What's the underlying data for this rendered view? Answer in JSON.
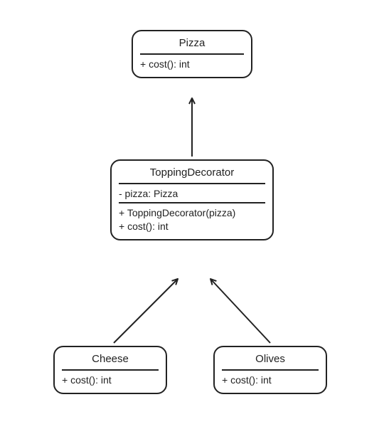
{
  "classes": {
    "pizza": {
      "name": "Pizza",
      "methods": [
        "+ cost(): int"
      ]
    },
    "decorator": {
      "name": "ToppingDecorator",
      "attributes": [
        "- pizza: Pizza"
      ],
      "methods": [
        "+ ToppingDecorator(pizza)",
        "+ cost(): int"
      ]
    },
    "cheese": {
      "name": "Cheese",
      "methods": [
        "+ cost(): int"
      ]
    },
    "olives": {
      "name": "Olives",
      "methods": [
        "+ cost(): int"
      ]
    }
  },
  "relations": [
    {
      "from": "decorator",
      "to": "pizza",
      "type": "inheritance"
    },
    {
      "from": "cheese",
      "to": "decorator",
      "type": "inheritance"
    },
    {
      "from": "olives",
      "to": "decorator",
      "type": "inheritance"
    }
  ]
}
